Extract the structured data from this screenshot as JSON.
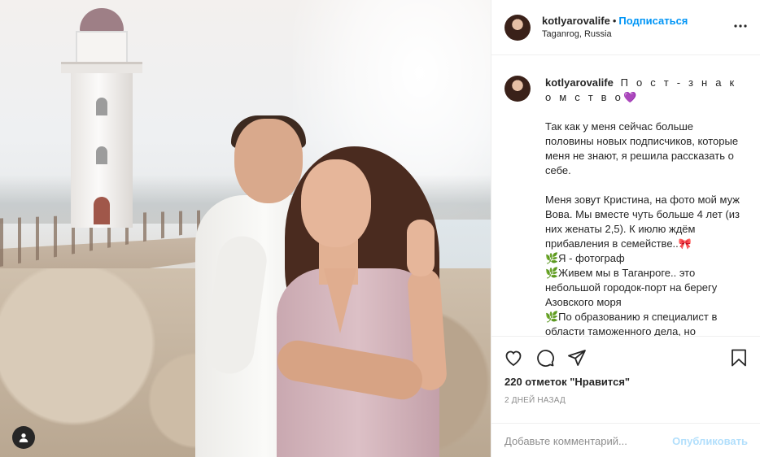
{
  "header": {
    "username": "kotlyarovalife",
    "separator": "•",
    "follow_label": "Подписаться",
    "location": "Taganrog, Russia"
  },
  "caption": {
    "username": "kotlyarovalife",
    "title": "П о с т - з н а к о м с т в о",
    "heart": "💜",
    "paragraph1": "Так как у меня сейчас больше половины новых подписчиков, которые меня не знают, я решила рассказать о себе.",
    "paragraph2": "Меня зовут Кристина, на фото мой муж Вова. Мы вместе чуть больше 4 лет (из них женаты 2,5). К июлю ждём прибавления в семействе..🎀",
    "list": "🌿Я - фотограф\n🌿Живем мы в Таганроге.. это небольшой городок-порт на берегу Азовского моря\n🌿По образованию я специалист в области таможенного дела, но"
  },
  "post": {
    "likes": "220 отметок \"Нравится\"",
    "posted_ago": "2 ДНЕЙ НАЗАД"
  },
  "comment": {
    "placeholder": "Добавьте комментарий...",
    "publish_label": "Опубликовать"
  },
  "colors": {
    "accent": "#0095f6",
    "publish_disabled": "#b2dffc",
    "heart": "#8a2be2"
  },
  "icons": [
    "more-options-icon",
    "like-heart-icon",
    "comment-icon",
    "share-icon",
    "save-bookmark-icon",
    "user-tag-icon"
  ]
}
